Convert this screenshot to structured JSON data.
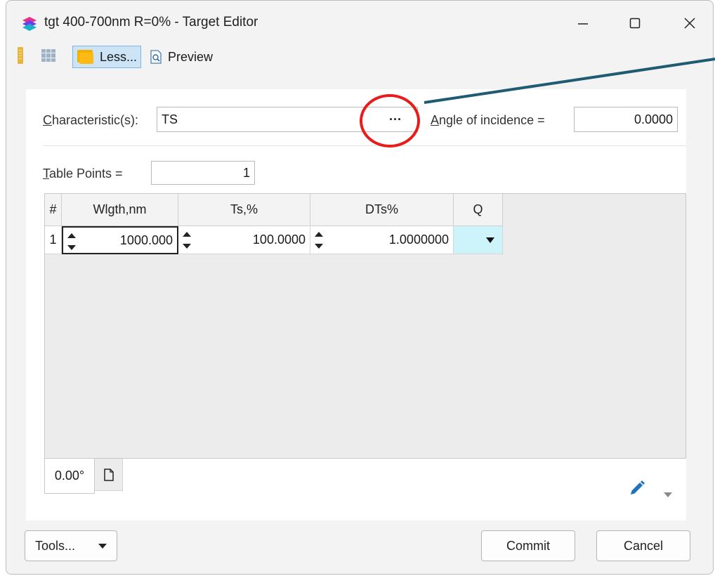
{
  "window": {
    "title": "tgt 400-700nm R=0% - Target Editor",
    "minimize_icon": "minimize-icon",
    "maximize_icon": "maximize-icon",
    "close_icon": "close-icon"
  },
  "toolbar": {
    "less_label": "Less...",
    "preview_label": "Preview"
  },
  "form": {
    "characteristic_label_hotkey": "C",
    "characteristic_label_rest": "haracteristic(s):",
    "characteristic_value": "TS",
    "browse_label": "···",
    "angle_label_hotkey": "A",
    "angle_label_rest": "ngle of incidence =",
    "angle_value": "0.0000",
    "table_points_label_hotkey": "T",
    "table_points_label_rest": "able Points =",
    "table_points_value": "1"
  },
  "table": {
    "columns": [
      "#",
      "Wlgth,nm",
      "Ts,%",
      "DTs%",
      "Q"
    ],
    "rows": [
      {
        "index": "1",
        "wavelength": "1000.000",
        "ts": "100.0000",
        "dts": "1.0000000",
        "q": ""
      }
    ]
  },
  "tabs": {
    "active_label": "0.00°",
    "add_icon": "new-page-icon"
  },
  "footer": {
    "tools_label": "Tools...",
    "commit_label": "Commit",
    "cancel_label": "Cancel"
  },
  "colors": {
    "accent": "#1e73be",
    "annotation_red": "#e81c1c",
    "annotation_line": "#1f5c73",
    "q_cell": "#cdf3fb"
  }
}
